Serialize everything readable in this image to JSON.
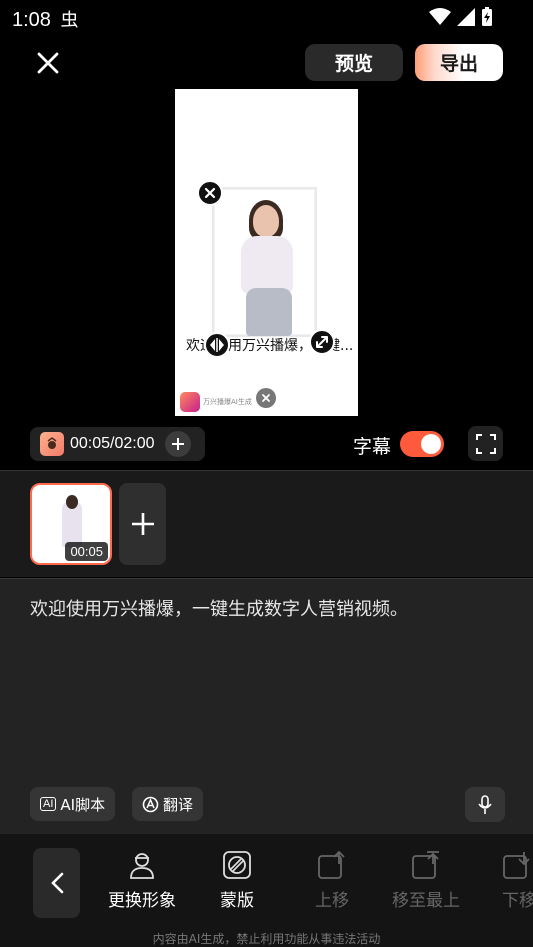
{
  "status": {
    "time": "1:08",
    "carrier_glyph": "虫"
  },
  "top": {
    "preview_label": "预览",
    "export_label": "导出"
  },
  "canvas": {
    "subtitle": "欢迎使用万兴播爆，一键...",
    "watermark": "万兴播爆AI生成"
  },
  "controls": {
    "time": "00:05/02:00",
    "subtitle_label": "字幕",
    "subtitle_enabled": true
  },
  "clips": [
    {
      "duration": "00:05"
    }
  ],
  "script": {
    "text": "欢迎使用万兴播爆，一键生成数字人营销视频。",
    "ai_script_label": "AI脚本",
    "ai_badge": "AI",
    "translate_label": "翻译"
  },
  "toolbar": {
    "items": [
      {
        "label": "更换形象",
        "enabled": true
      },
      {
        "label": "蒙版",
        "enabled": true
      },
      {
        "label": "上移",
        "enabled": false
      },
      {
        "label": "移至最上",
        "enabled": false
      },
      {
        "label": "下移",
        "enabled": false
      }
    ]
  },
  "footer": "内容由AI生成，禁止利用功能从事违法活动",
  "colors": {
    "accent": "#ff5a3c",
    "background": "#000000",
    "panel": "#232323"
  }
}
